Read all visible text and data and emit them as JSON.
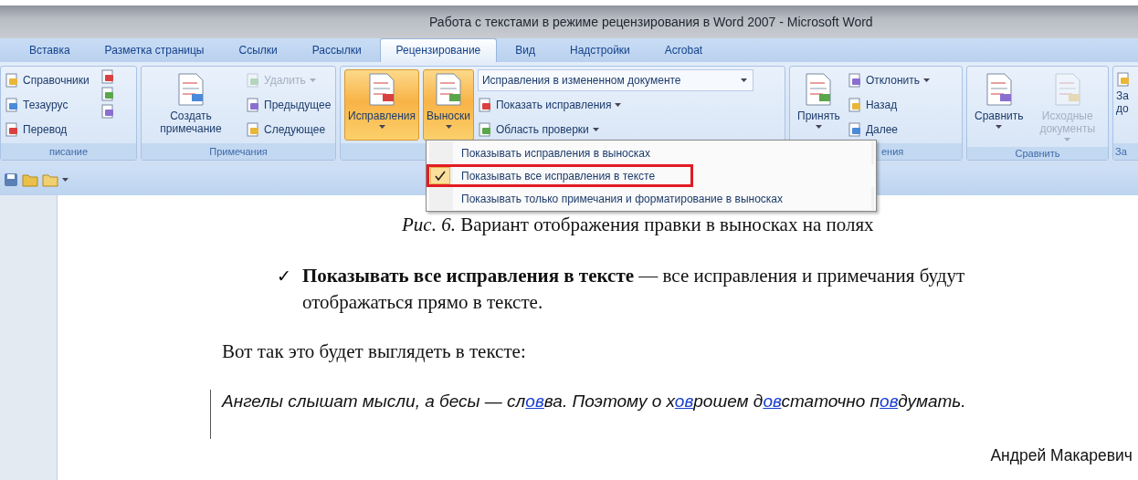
{
  "window": {
    "title": "Работа с текстами в режиме рецензирования в Word 2007 - Microsoft Word"
  },
  "tabs": [
    {
      "label": "Вставка",
      "selected": false
    },
    {
      "label": "Разметка страницы",
      "selected": false
    },
    {
      "label": "Ссылки",
      "selected": false
    },
    {
      "label": "Рассылки",
      "selected": false
    },
    {
      "label": "Рецензирование",
      "selected": true
    },
    {
      "label": "Вид",
      "selected": false
    },
    {
      "label": "Надстройки",
      "selected": false
    },
    {
      "label": "Acrobat",
      "selected": false
    }
  ],
  "ribbon": {
    "groups": [
      {
        "label": "писание",
        "columns": [
          {
            "kind": "small",
            "items": [
              {
                "label": "Справочники",
                "disabled": false,
                "menu": false
              },
              {
                "label": "Тезаурус",
                "disabled": false,
                "menu": false
              },
              {
                "label": "Перевод",
                "disabled": false,
                "menu": false
              }
            ]
          },
          {
            "kind": "icons"
          }
        ]
      },
      {
        "label": "Примечания",
        "columns": [
          {
            "kind": "large",
            "items": [
              {
                "label": "Создать примечание",
                "disabled": false,
                "active": false,
                "menu": false
              }
            ]
          },
          {
            "kind": "small",
            "items": [
              {
                "label": "Удалить",
                "disabled": true,
                "menu": true
              },
              {
                "label": "Предыдущее",
                "disabled": false,
                "menu": false
              },
              {
                "label": "Следующее",
                "disabled": false,
                "menu": false
              }
            ]
          }
        ]
      },
      {
        "columns": [
          {
            "kind": "large",
            "items": [
              {
                "label": "Исправления",
                "disabled": false,
                "active": true,
                "menu": true
              },
              {
                "label": "Выноски",
                "disabled": false,
                "active": true,
                "menu": true
              }
            ]
          },
          {
            "kind": "small",
            "items": [
              {
                "label": "Исправления в измененном документе",
                "kind": "combo",
                "disabled": false,
                "menu": true
              },
              {
                "label": "Показать исправления",
                "disabled": false,
                "menu": true
              },
              {
                "label": "Область проверки",
                "disabled": false,
                "menu": true
              }
            ]
          }
        ]
      },
      {
        "label": "ения",
        "columns": [
          {
            "kind": "large",
            "items": [
              {
                "label": "Принять",
                "disabled": false,
                "active": false,
                "menu": true
              }
            ]
          },
          {
            "kind": "small",
            "items": [
              {
                "label": "Отклонить",
                "disabled": false,
                "menu": true
              },
              {
                "label": "Назад",
                "disabled": false,
                "menu": false
              },
              {
                "label": "Далее",
                "disabled": false,
                "menu": false
              }
            ]
          }
        ]
      },
      {
        "label": "Сравнить",
        "columns": [
          {
            "kind": "large",
            "items": [
              {
                "label": "Сравнить",
                "disabled": false,
                "active": false,
                "menu": true
              },
              {
                "label": "Исходные документы",
                "disabled": true,
                "active": false,
                "menu": true
              }
            ]
          }
        ]
      },
      {
        "label": "За",
        "columns": [
          {
            "kind": "large",
            "items": [
              {
                "label": "За до",
                "disabled": false,
                "active": false
              }
            ]
          }
        ]
      }
    ]
  },
  "menu": {
    "items": [
      {
        "label": "Показывать исправления в выносках",
        "checked": false,
        "highlighted": false
      },
      {
        "label": "Показывать все исправления в тексте",
        "checked": true,
        "highlighted": true
      },
      {
        "label": "Показывать только примечания и форматирование в выносках",
        "checked": false,
        "highlighted": false
      }
    ]
  },
  "document": {
    "caption": "*Рис. 6.* Вариант отображения правки в выносках на полях",
    "bullet": {
      "mark": "✓",
      "text": "**Показывать все исправления в тексте** — все исправления и примечания будут отображаться прямо в тексте."
    },
    "intro": "Вот так это будет выглядеть в тексте:",
    "quote": [
      {
        "text": "Ангелы слышат мысли, а бесы — сл",
        "inserted": false
      },
      {
        "text": "ов",
        "inserted": true
      },
      {
        "text": "ва. Поэтому о х",
        "inserted": false
      },
      {
        "text": "ов",
        "inserted": true
      },
      {
        "text": "рошем д",
        "inserted": false
      },
      {
        "text": "ов",
        "inserted": true
      },
      {
        "text": "статочно п",
        "inserted": false
      },
      {
        "text": "ов",
        "inserted": true
      },
      {
        "text": "думать.",
        "inserted": false
      }
    ],
    "author": "Андрей Макаревич"
  }
}
